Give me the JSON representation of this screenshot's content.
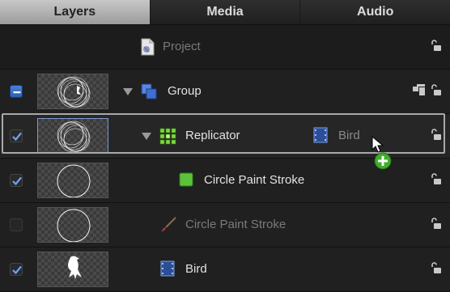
{
  "tabs": [
    {
      "label": "Layers",
      "active": true
    },
    {
      "label": "Media",
      "active": false
    },
    {
      "label": "Audio",
      "active": false
    }
  ],
  "rows": [
    {
      "label": "Project",
      "dimmed": true
    },
    {
      "label": "Group",
      "enabled": "mixed"
    },
    {
      "label": "Replicator",
      "enabled": true,
      "source_label": "Bird"
    },
    {
      "label": "Circle Paint Stroke",
      "enabled": true
    },
    {
      "label": "Circle Paint Stroke",
      "enabled": false,
      "dimmed": true
    },
    {
      "label": "Bird",
      "enabled": true
    }
  ],
  "icons": {
    "project": "project-document-icon",
    "group": "group-stack-icon",
    "replicator": "replicator-icon",
    "paint_stroke_active": "shape-square-icon",
    "paint_stroke_disabled": "paint-brush-icon",
    "image": "image-filmstrip-icon",
    "lock": "unlock-icon",
    "layer_mode": "layer-mode-icon",
    "cursor": "arrow-cursor-icon",
    "add": "add-plus-icon"
  },
  "colors": {
    "checkbox_mixed": "#3a6ccb",
    "add_badge": "#3fae2a",
    "replicator_green": "#7ddb3a",
    "group_blue": "#3d6fd6"
  }
}
